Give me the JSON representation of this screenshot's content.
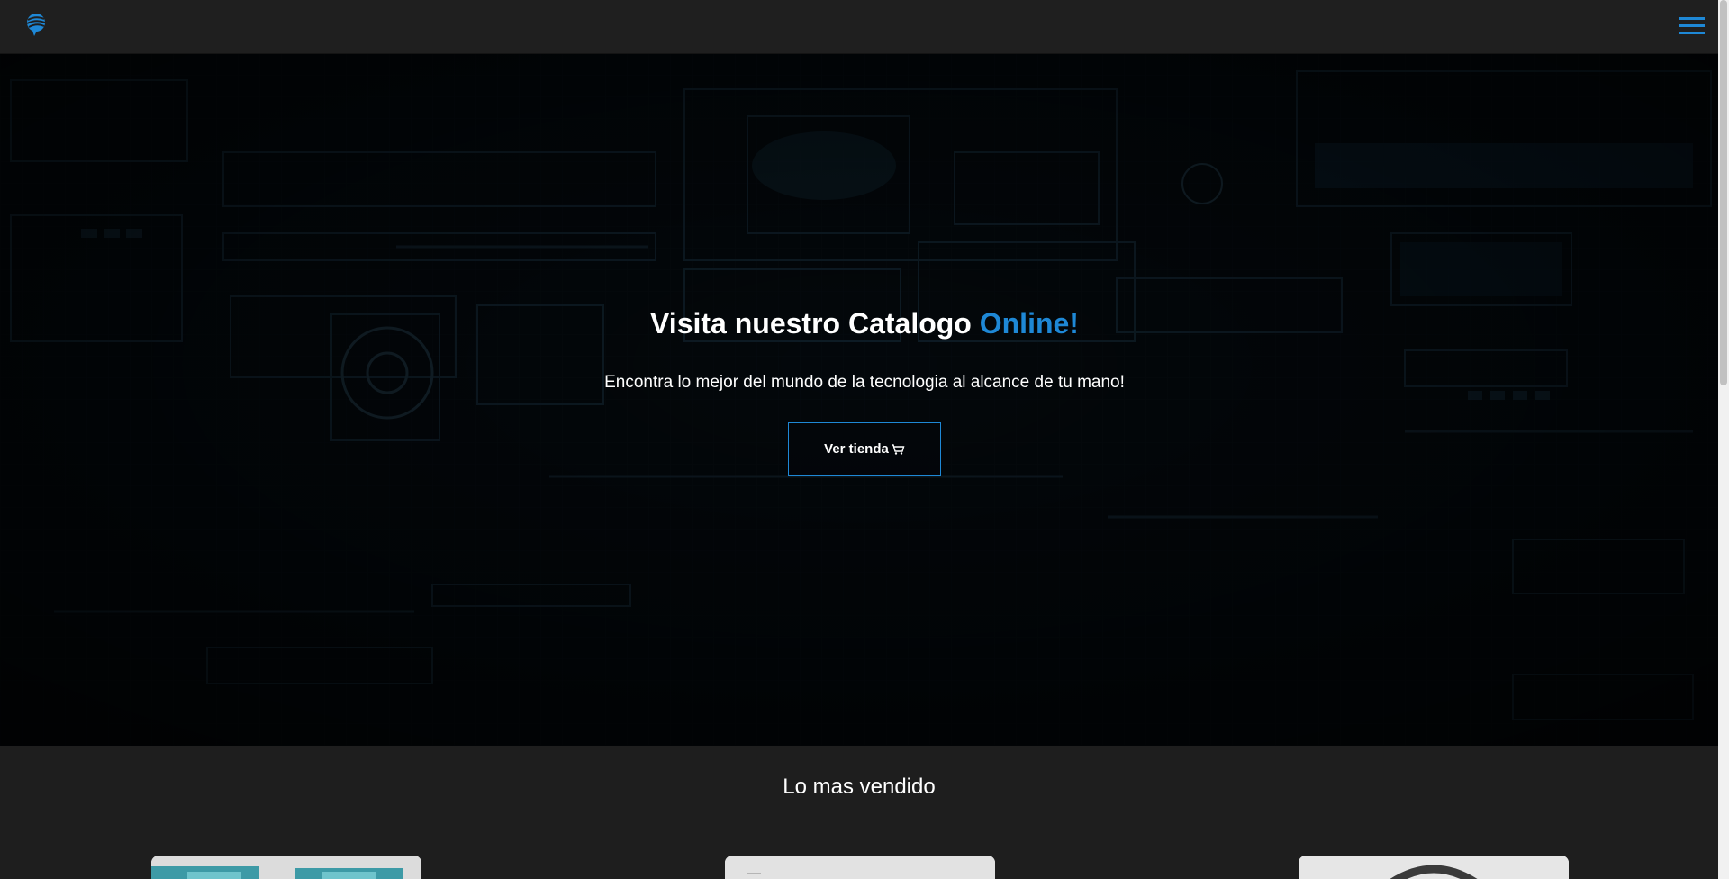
{
  "colors": {
    "accent": "#1e88d6",
    "navbar": "#1f1f1f",
    "page_background": "#1e1e1e",
    "hero_background": "#05070a"
  },
  "navbar": {
    "logo_icon": "globe-swirl-logo",
    "menu_icon": "hamburger-menu-icon"
  },
  "hero": {
    "title_main": "Visita nuestro Catalogo ",
    "title_accent": "Online!",
    "subtitle": "Encontra lo mejor del mundo de la tecnologia al alcance de tu mano!",
    "button_label": "Ver tienda",
    "button_icon": "shopping-cart-icon"
  },
  "bestsellers": {
    "title": "Lo mas vendido"
  }
}
